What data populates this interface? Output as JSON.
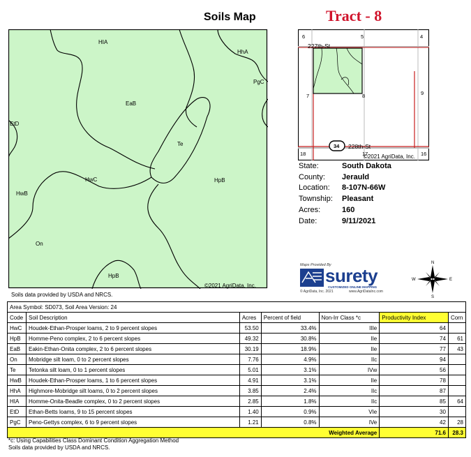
{
  "header": {
    "title": "Soils Map",
    "tract": "Tract - 8"
  },
  "soil_map": {
    "labels": [
      "HIA",
      "HhA",
      "PgC",
      "EaB",
      "EtD",
      "Te",
      "HwC",
      "HpB",
      "HwB",
      "On",
      "HpB"
    ],
    "source": "Soils data provided by USDA and NRCS.",
    "copyright": "©2021 AgriData, Inc."
  },
  "location_map": {
    "road_top": "227th-St",
    "road_bottom": "228th-St",
    "highway": "34",
    "sections": [
      "6",
      "5",
      "4",
      "7",
      "8",
      "9",
      "18",
      "17",
      "16"
    ],
    "copyright": "©2021 AgriData, Inc."
  },
  "info": [
    {
      "key": "State:",
      "value": "South Dakota"
    },
    {
      "key": "County:",
      "value": "Jerauld"
    },
    {
      "key": "Location:",
      "value": "8-107N-66W"
    },
    {
      "key": "Township:",
      "value": "Pleasant"
    },
    {
      "key": "Acres:",
      "value": "160"
    },
    {
      "key": "Date:",
      "value": "9/11/2021"
    }
  ],
  "logo": {
    "provided_by": "Maps Provided By",
    "brand": "surety",
    "tagline": "CUSTOMIZED ONLINE MAPPING",
    "small": "© AgriData, Inc. 2021",
    "url": "www.AgriDataInc.com"
  },
  "compass": {
    "n": "N",
    "s": "S",
    "e": "E",
    "w": "W"
  },
  "table": {
    "area_symbol": "Area Symbol: SD073, Soil Area Version: 24",
    "headers": [
      "Code",
      "Soil Description",
      "Acres",
      "Percent of field",
      "Non-Irr Class *c",
      "Productivity Index",
      "Corn"
    ],
    "rows": [
      {
        "code": "HwC",
        "desc": "Houdek-Ethan-Prosper loams, 2 to 9 percent slopes",
        "acres": "53.50",
        "pct": "33.4%",
        "cls": "IIIe",
        "pi": "64",
        "corn": ""
      },
      {
        "code": "HpB",
        "desc": "Homme-Peno complex, 2 to 6 percent slopes",
        "acres": "49.32",
        "pct": "30.8%",
        "cls": "IIe",
        "pi": "74",
        "corn": "61"
      },
      {
        "code": "EaB",
        "desc": "Eakin-Ethan-Onita complex, 2 to 6 percent slopes",
        "acres": "30.19",
        "pct": "18.9%",
        "cls": "IIe",
        "pi": "77",
        "corn": "43"
      },
      {
        "code": "On",
        "desc": "Mobridge silt loam, 0 to 2 percent slopes",
        "acres": "7.76",
        "pct": "4.9%",
        "cls": "IIc",
        "pi": "94",
        "corn": ""
      },
      {
        "code": "Te",
        "desc": "Tetonka silt loam, 0 to 1 percent slopes",
        "acres": "5.01",
        "pct": "3.1%",
        "cls": "IVw",
        "pi": "56",
        "corn": ""
      },
      {
        "code": "HwB",
        "desc": "Houdek-Ethan-Prosper loams, 1 to 6 percent slopes",
        "acres": "4.91",
        "pct": "3.1%",
        "cls": "IIe",
        "pi": "78",
        "corn": ""
      },
      {
        "code": "HhA",
        "desc": "Highmore-Mobridge silt loams, 0 to 2 percent slopes",
        "acres": "3.85",
        "pct": "2.4%",
        "cls": "IIc",
        "pi": "87",
        "corn": ""
      },
      {
        "code": "HIA",
        "desc": "Homme-Onita-Beadle complex, 0 to 2 percent slopes",
        "acres": "2.85",
        "pct": "1.8%",
        "cls": "IIc",
        "pi": "85",
        "corn": "64"
      },
      {
        "code": "EtD",
        "desc": "Ethan-Betts loams, 9 to 15 percent slopes",
        "acres": "1.40",
        "pct": "0.9%",
        "cls": "VIe",
        "pi": "30",
        "corn": ""
      },
      {
        "code": "PgC",
        "desc": "Peno-Gettys complex, 6 to 9 percent slopes",
        "acres": "1.21",
        "pct": "0.8%",
        "cls": "IVe",
        "pi": "42",
        "corn": "28"
      }
    ],
    "weighted": {
      "label": "Weighted Average",
      "pi": "71.6",
      "corn": "28.3"
    }
  },
  "footnotes": [
    "*c: Using Capabilities Class Dominant Condition Aggregation Method",
    "Soils data provided by USDA and NRCS."
  ],
  "colors": {
    "map_fill": "#ccf5c8",
    "highlight": "#ffff33",
    "tract_red": "#d0142c",
    "road_red": "#c81e1e"
  }
}
